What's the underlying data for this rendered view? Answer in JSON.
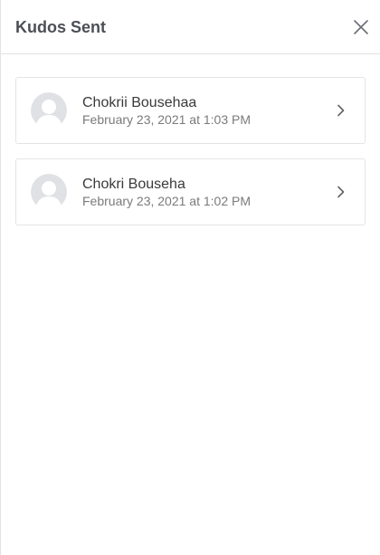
{
  "header": {
    "title": "Kudos Sent"
  },
  "kudos": [
    {
      "name": "Chokrii Bousehaa",
      "date": "February 23, 2021 at 1:03 PM"
    },
    {
      "name": "Chokri Bouseha",
      "date": "February 23, 2021 at 1:02 PM"
    }
  ],
  "icons": {
    "close": "close-icon",
    "avatar": "user-silhouette-icon",
    "chevron": "chevron-right-icon"
  },
  "colors": {
    "title": "#4b4f56",
    "name": "#3a3a3a",
    "date": "#7a7a7a",
    "avatar_bg": "#dfe1e5",
    "avatar_fg": "#ffffff",
    "border": "#e4e4e4"
  }
}
